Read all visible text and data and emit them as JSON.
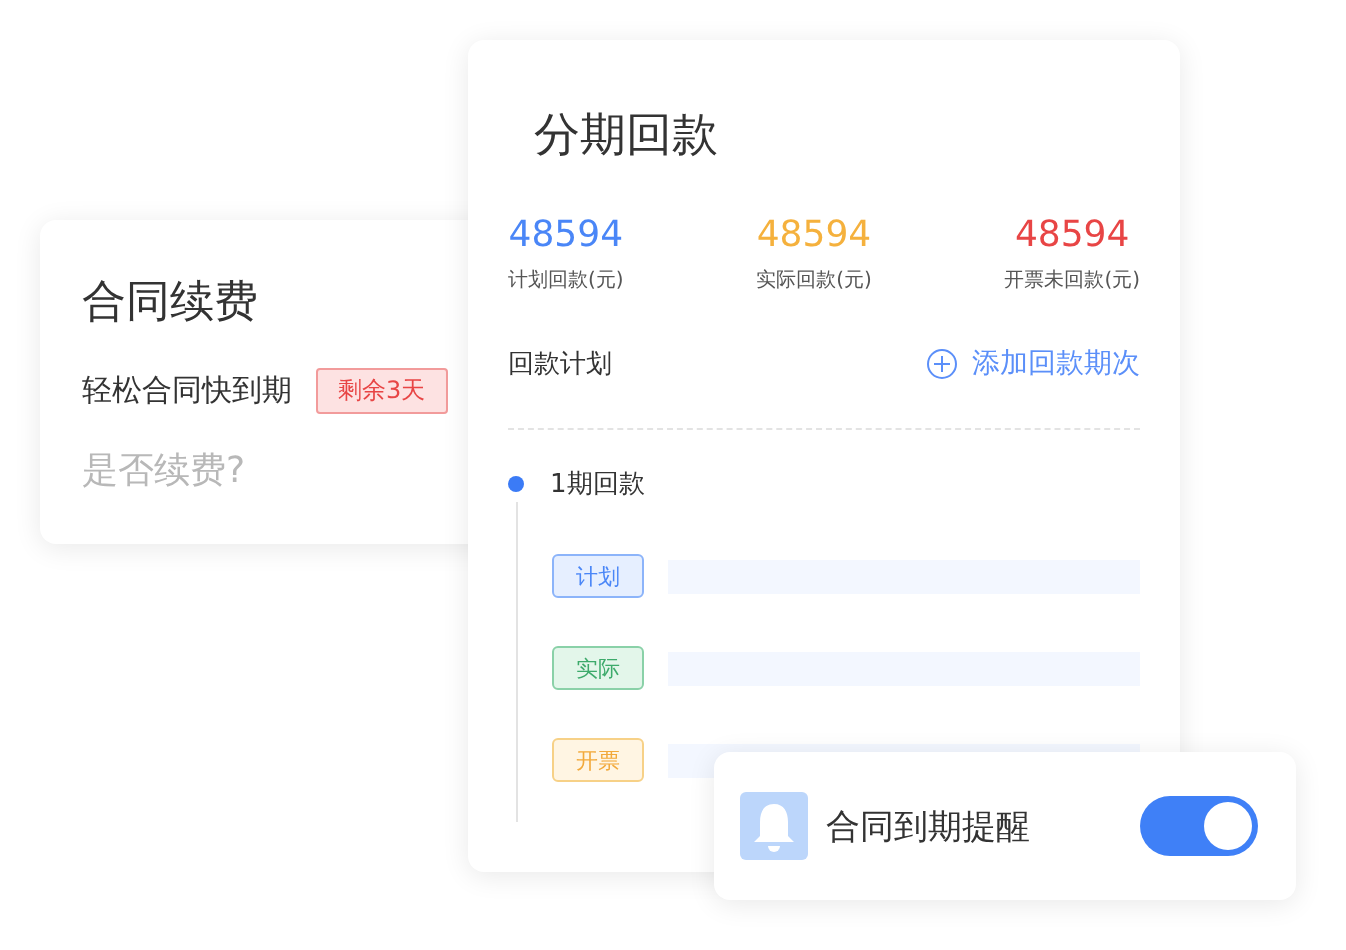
{
  "renewal_card": {
    "title": "合同续费",
    "message": "轻松合同快到期",
    "badge": "剩余3天",
    "question": "是否续费?"
  },
  "installment_card": {
    "title": "分期回款",
    "stats": [
      {
        "value": "48594",
        "label": "计划回款(元)",
        "color": "#4a86f7"
      },
      {
        "value": "48594",
        "label": "实际回款(元)",
        "color": "#f5b13d"
      },
      {
        "value": "48594",
        "label": "开票未回款(元)",
        "color": "#e84545"
      }
    ],
    "plan_title": "回款计划",
    "add_button": "添加回款期次",
    "periods": [
      {
        "title": "1期回款",
        "rows": [
          {
            "tag": "计划",
            "kind": "plan"
          },
          {
            "tag": "实际",
            "kind": "actual"
          },
          {
            "tag": "开票",
            "kind": "invoice"
          }
        ]
      }
    ]
  },
  "reminder_card": {
    "label": "合同到期提醒",
    "on": true
  }
}
